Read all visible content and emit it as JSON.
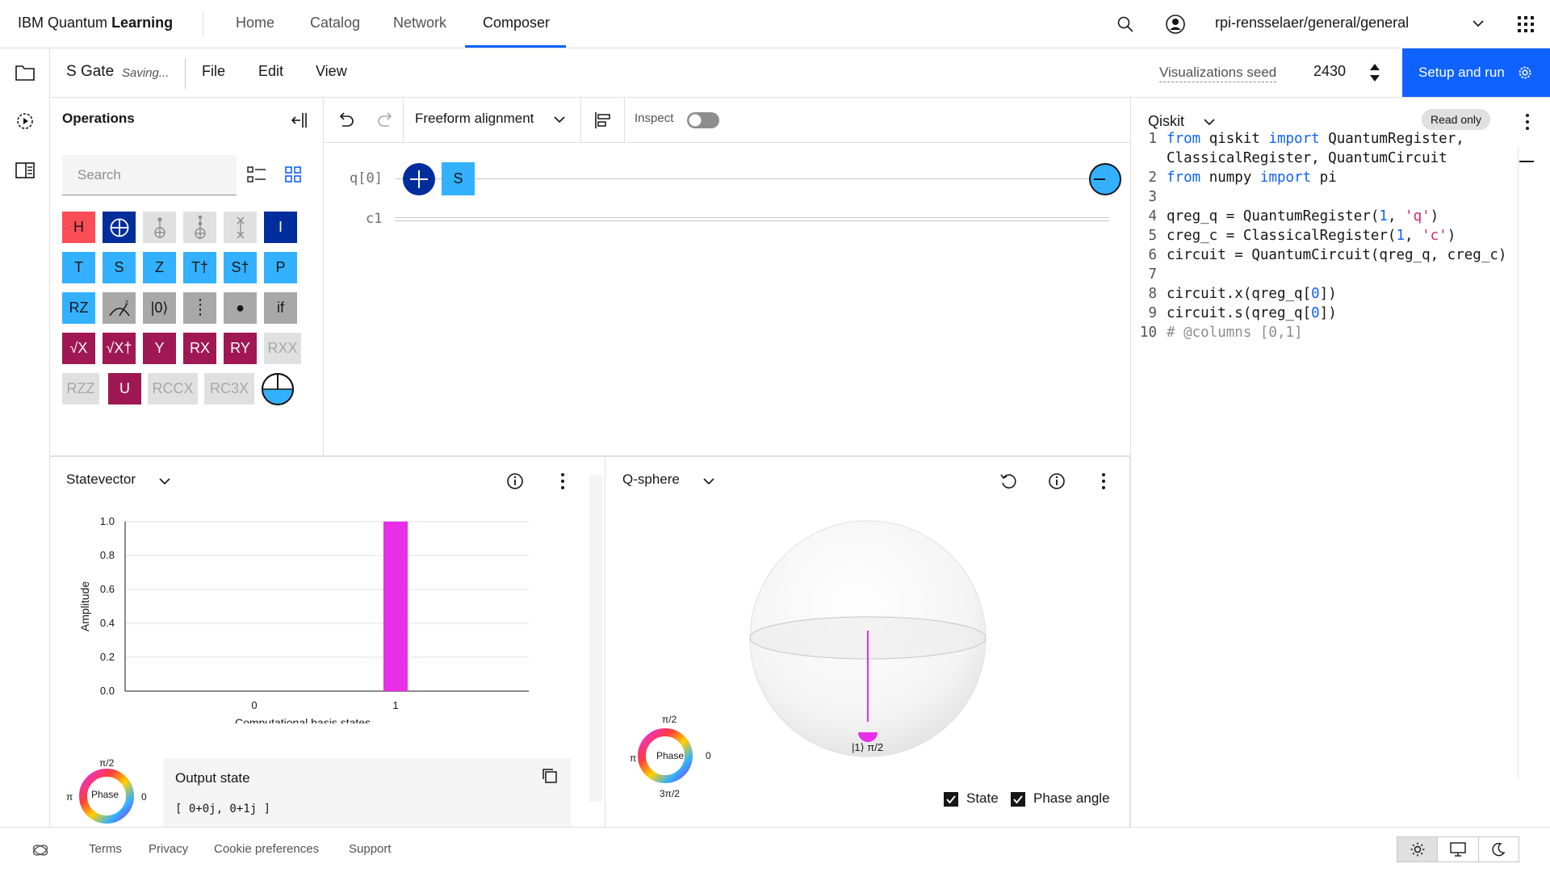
{
  "nav": {
    "brand_plain": "IBM Quantum",
    "brand_bold": "Learning",
    "links": [
      "Home",
      "Catalog",
      "Network",
      "Composer"
    ],
    "active": "Composer",
    "workspace": "rpi-rensselaer/general/general"
  },
  "toolbar": {
    "title": "S Gate",
    "saving": "Saving...",
    "menus": [
      "File",
      "Edit",
      "View"
    ],
    "seed_label": "Visualizations seed",
    "seed_value": "2430",
    "run_label": "Setup and run"
  },
  "operations": {
    "title": "Operations",
    "search_placeholder": "Search",
    "gates": [
      [
        "H",
        "⊕",
        "",
        "",
        "",
        "I"
      ],
      [
        "T",
        "S",
        "Z",
        "T†",
        "S†",
        "P"
      ],
      [
        "RZ",
        "",
        "|0⟩",
        "",
        "●",
        "if"
      ],
      [
        "√X",
        "√X†",
        "Y",
        "RX",
        "RY",
        "RXX"
      ],
      [
        "RZZ",
        "U",
        "RCCX",
        "RC3X",
        ""
      ]
    ]
  },
  "circuit": {
    "alignment": "Freeform alignment",
    "inspect_label": "Inspect",
    "qubit_label": "q[0]",
    "classical_label": "c1",
    "gate_s": "S"
  },
  "code": {
    "language": "Qiskit",
    "badge": "Read only",
    "lines": [
      {
        "n": "1",
        "html": "<span class=\"kw\">from</span> qiskit <span class=\"kw\">import</span> QuantumRegister,"
      },
      {
        "n": "",
        "html": "ClassicalRegister, QuantumCircuit"
      },
      {
        "n": "2",
        "html": "<span class=\"kw\">from</span> numpy <span class=\"kw\">import</span> pi"
      },
      {
        "n": "3",
        "html": ""
      },
      {
        "n": "4",
        "html": "qreg_q = QuantumRegister(<span class=\"num\">1</span>, <span class=\"str\">'q'</span>)"
      },
      {
        "n": "5",
        "html": "creg_c = ClassicalRegister(<span class=\"num\">1</span>, <span class=\"str\">'c'</span>)"
      },
      {
        "n": "6",
        "html": "circuit = QuantumCircuit(qreg_q, creg_c)"
      },
      {
        "n": "7",
        "html": ""
      },
      {
        "n": "8",
        "html": "circuit.x(qreg_q[<span class=\"num\">0</span>])"
      },
      {
        "n": "9",
        "html": "circuit.s(qreg_q[<span class=\"num\">0</span>])"
      },
      {
        "n": "10",
        "html": "<span class=\"cmt\"># @columns [0,1]</span>"
      }
    ]
  },
  "statevector": {
    "title": "Statevector",
    "output_title": "Output state",
    "output_value": "[ 0+0j, 0+1j ]",
    "phase_label": "Phase",
    "phase_top": "π/2",
    "phase_left": "π",
    "phase_right": "0"
  },
  "chart_data": {
    "type": "bar",
    "categories": [
      "0",
      "1"
    ],
    "values": [
      0,
      1.0
    ],
    "xlabel": "Computational basis states",
    "ylabel": "Amplitude",
    "ylim": [
      0,
      1.0
    ],
    "yticks": [
      "0.0",
      "0.2",
      "0.4",
      "0.6",
      "0.8",
      "1.0"
    ],
    "bar_color": "#e62fe7"
  },
  "qsphere": {
    "title": "Q-sphere",
    "state_label": "|1⟩ π/2",
    "phase_label": "Phase",
    "phase_top": "π/2",
    "phase_left": "π",
    "phase_right": "0",
    "phase_bottom": "3π/2",
    "checkbox_state": "State",
    "checkbox_phase": "Phase angle"
  },
  "footer": {
    "links": [
      "Terms",
      "Privacy",
      "Cookie preferences",
      "Support"
    ]
  },
  "colors": {
    "accent": "#0f62fe",
    "magenta": "#e62fe7"
  }
}
